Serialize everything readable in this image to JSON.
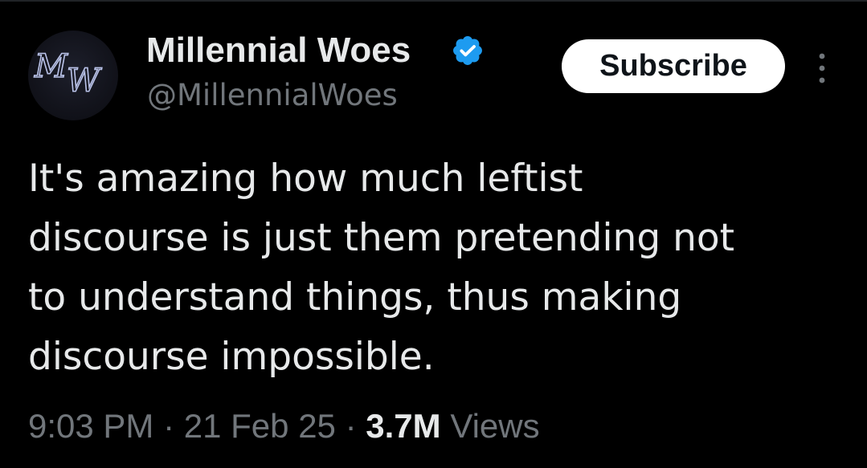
{
  "author": {
    "display_name": "Millennial Woes",
    "handle": "@MillennialWoes",
    "avatar_text": "MW",
    "verified_icon": "verified-badge-icon"
  },
  "actions": {
    "subscribe_label": "Subscribe",
    "more_icon": "more-options-icon"
  },
  "tweet": {
    "lines": [
      "It's amazing how much leftist",
      "discourse is just them pretending not",
      "to understand things, thus making",
      "discourse impossible."
    ]
  },
  "meta": {
    "time": "9:03 PM",
    "separator": "·",
    "date": "21 Feb 25",
    "views_count": "3.7M",
    "views_label": "Views"
  },
  "colors": {
    "background": "#000000",
    "primary_text": "#e7e9ea",
    "secondary_text": "#71767b",
    "verified_blue": "#1d9bf0",
    "button_bg": "#ffffff",
    "button_text": "#0f1419"
  }
}
